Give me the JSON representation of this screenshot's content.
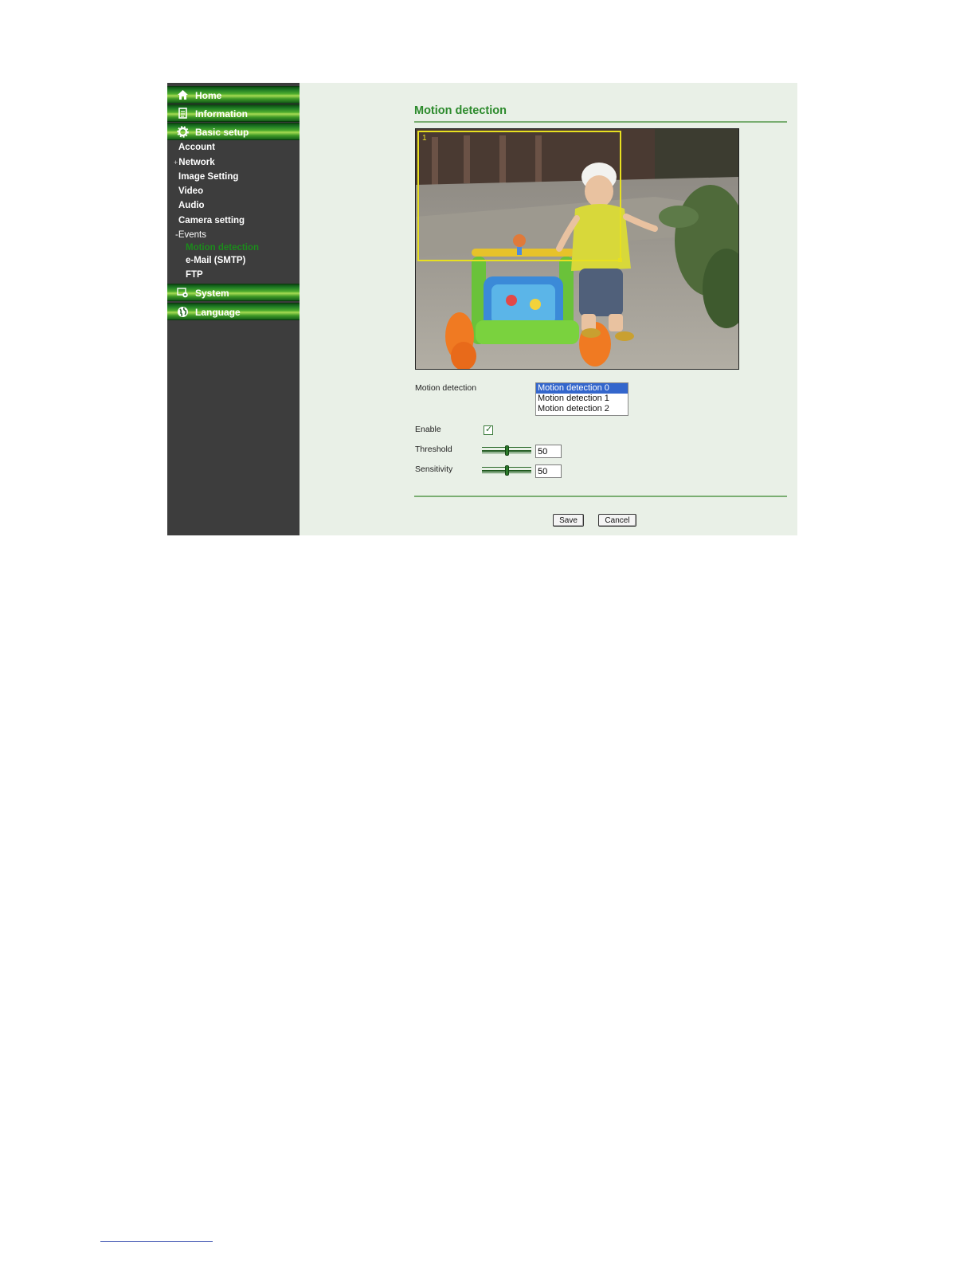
{
  "sidebar": {
    "nav": [
      {
        "label": "Home",
        "icon": "home-icon"
      },
      {
        "label": "Information",
        "icon": "document-icon"
      },
      {
        "label": "Basic setup",
        "icon": "gear-icon"
      },
      {
        "label": "System",
        "icon": "system-icon"
      },
      {
        "label": "Language",
        "icon": "globe-icon"
      }
    ],
    "basic_setup_items": {
      "account": "Account",
      "network": "Network",
      "image_setting": "Image Setting",
      "video": "Video",
      "audio": "Audio",
      "camera_setting": "Camera setting",
      "events": "Events"
    },
    "events_items": {
      "motion_detection": "Motion detection",
      "email": "e-Mail (SMTP)",
      "ftp": "FTP"
    },
    "markers": {
      "collapsed": "+",
      "expanded": "-"
    },
    "active_item": "Motion detection"
  },
  "main": {
    "title": "Motion detection",
    "video": {
      "window_label": "1"
    },
    "form": {
      "motion_detection_label": "Motion detection",
      "options": [
        "Motion detection 0",
        "Motion detection 1",
        "Motion detection 2"
      ],
      "selected_option": "Motion detection 0",
      "enable_label": "Enable",
      "enable_checked": true,
      "threshold_label": "Threshold",
      "threshold_value": "50",
      "sensitivity_label": "Sensitivity",
      "sensitivity_value": "50"
    },
    "buttons": {
      "save": "Save",
      "cancel": "Cancel"
    }
  },
  "colors": {
    "accent": "#2c8a2c",
    "sidebar_bg": "#3d3d3d",
    "content_bg": "#e9f0e7",
    "motion_window": "#e8e020",
    "selected_option": "#3366cc"
  }
}
